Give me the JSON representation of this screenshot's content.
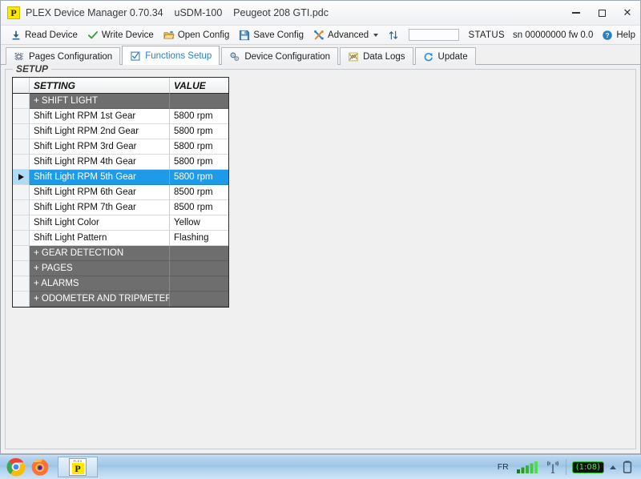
{
  "window": {
    "logo_letter": "P",
    "title": "PLEX Device Manager 0.70.34    uSDM-100    Peugeot 208 GTI.pdc",
    "minimize_label": "Minimize",
    "maximize_label": "Maximize",
    "close_label": "Close"
  },
  "toolbar": {
    "read_device": "Read Device",
    "write_device": "Write Device",
    "open_config": "Open Config",
    "save_config": "Save Config",
    "advanced": "Advanced",
    "progress_value": "",
    "status_label": "STATUS",
    "device_info": "sn 00000000 fw 0.0",
    "help": "Help"
  },
  "tabs": [
    {
      "label": "Pages Configuration",
      "icon": "pages-icon",
      "active": false
    },
    {
      "label": "Functions Setup",
      "icon": "checkbox-icon",
      "active": true
    },
    {
      "label": "Device Configuration",
      "icon": "gears-icon",
      "active": false
    },
    {
      "label": "Data Logs",
      "icon": "scatter-icon",
      "active": false
    },
    {
      "label": "Update",
      "icon": "refresh-icon",
      "active": false
    }
  ],
  "setup_group": {
    "legend": "SETUP",
    "columns": {
      "gutter": "",
      "setting": "SETTING",
      "value": "VALUE"
    },
    "rows": [
      {
        "type": "group",
        "setting": "+ SHIFT LIGHT",
        "value": ""
      },
      {
        "type": "item",
        "setting": "Shift Light RPM 1st Gear",
        "value": "5800 rpm"
      },
      {
        "type": "item",
        "setting": "Shift Light RPM 2nd Gear",
        "value": "5800 rpm"
      },
      {
        "type": "item",
        "setting": "Shift Light RPM 3rd Gear",
        "value": "5800 rpm"
      },
      {
        "type": "item",
        "setting": "Shift Light RPM 4th Gear",
        "value": "5800 rpm"
      },
      {
        "type": "item",
        "setting": "Shift Light RPM 5th Gear",
        "value": "5800 rpm",
        "selected": true
      },
      {
        "type": "item",
        "setting": "Shift Light RPM 6th Gear",
        "value": "8500 rpm"
      },
      {
        "type": "item",
        "setting": "Shift Light RPM 7th Gear",
        "value": "8500 rpm"
      },
      {
        "type": "item",
        "setting": "Shift Light Color",
        "value": "Yellow"
      },
      {
        "type": "item",
        "setting": "Shift Light Pattern",
        "value": "Flashing"
      },
      {
        "type": "group",
        "setting": "+ GEAR DETECTION",
        "value": ""
      },
      {
        "type": "group",
        "setting": "+ PAGES",
        "value": ""
      },
      {
        "type": "group",
        "setting": "+ ALARMS",
        "value": ""
      },
      {
        "type": "group",
        "setting": "+ ODOMETER AND TRIPMETER",
        "value": ""
      }
    ]
  },
  "taskbar": {
    "apps": [
      {
        "name": "chrome",
        "label": "Google Chrome"
      },
      {
        "name": "firefox",
        "label": "Mozilla Firefox"
      }
    ],
    "active_task": {
      "mini_word": "PLEX",
      "letter": "P"
    },
    "tray": {
      "language": "FR",
      "signal": "signal-bars-icon",
      "wireless": "wireless-icon",
      "battery_time": "(1:08)",
      "show_hidden": "show-hidden-icon",
      "battery": "battery-icon"
    }
  },
  "colors": {
    "selection_blue": "#1e9ae8",
    "group_gray": "#6e6e6e",
    "accent_tab_blue": "#1e7fd4",
    "logo_yellow": "#ffe800"
  }
}
